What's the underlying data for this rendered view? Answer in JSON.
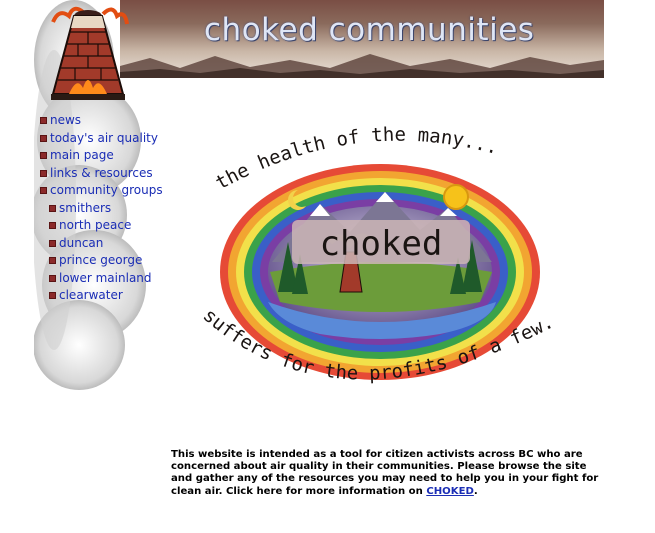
{
  "header": {
    "title": "choked communities"
  },
  "nav": {
    "items": [
      {
        "label": "news",
        "sub": false
      },
      {
        "label": "today's air quality",
        "sub": false
      },
      {
        "label": "main page",
        "sub": false
      },
      {
        "label": "links & resources",
        "sub": false
      },
      {
        "label": "community groups",
        "sub": false
      },
      {
        "label": "smithers",
        "sub": true
      },
      {
        "label": "north peace",
        "sub": true
      },
      {
        "label": "duncan",
        "sub": true
      },
      {
        "label": "prince george",
        "sub": true
      },
      {
        "label": "lower mainland",
        "sub": true
      },
      {
        "label": "clearwater",
        "sub": true
      }
    ]
  },
  "art": {
    "top_text": "the health of the many...",
    "center_text": "choked",
    "bottom_text": "suffers for the profits of a few."
  },
  "intro": {
    "text": "This website is intended as a tool for citizen activists across BC who are concerned about air quality in their communities. Please browse the site and gather any of the resources you may need to help you in your fight for clean air. Click here for more information on ",
    "link": "CHOKED",
    "end": "."
  },
  "colors": {
    "link": "#1a2db5",
    "bullet": "#8b2a2a"
  }
}
